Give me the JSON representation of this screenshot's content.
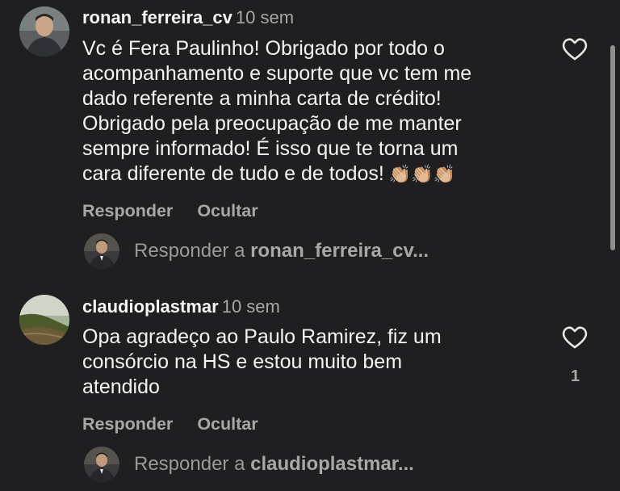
{
  "comments": [
    {
      "username": "ronan_ferreira_cv",
      "time": "10 sem",
      "lines": [
        "Vc é Fera Paulinho! Obrigado por todo o",
        "acompanhamento e suporte que vc tem me",
        "dado referente a minha carta de crédito!",
        "Obrigado pela preocupação de me manter",
        "sempre informado! É isso que te torna um",
        "cara diferente de tudo e de todos!"
      ],
      "claps": "👏🏼👏🏼👏🏼",
      "reply_label": "Responder",
      "hide_label": "Ocultar",
      "reply_prompt_prefix": "Responder a ",
      "reply_prompt_user": "ronan_ferreira_cv..."
    },
    {
      "username": "claudioplastmar",
      "time": "10 sem",
      "lines": [
        "Opa agradeço ao Paulo Ramirez,  fiz um",
        "consórcio na HS e estou muito bem",
        "atendido"
      ],
      "likes": "1",
      "reply_label": "Responder",
      "hide_label": "Ocultar",
      "reply_prompt_prefix": "Responder a ",
      "reply_prompt_user": "claudioplastmar..."
    }
  ],
  "colors": {
    "background": "#1f1f21",
    "text": "#f4f4f4",
    "muted": "#a8a8a8"
  },
  "icons": {
    "like": "heart-icon"
  }
}
